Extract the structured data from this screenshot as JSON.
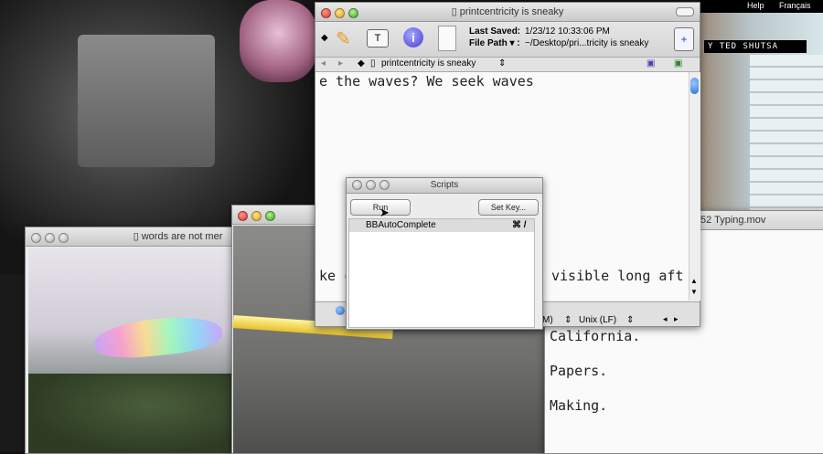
{
  "menubar": {
    "help": "Help",
    "language": "Français"
  },
  "credit": "Y TED SHUTSA",
  "bbedit": {
    "title": "printcentricity is sneaky",
    "last_saved_label": "Last Saved:",
    "last_saved_value": "1/23/12 10:33:06 PM",
    "file_path_label": "File Path ▾ :",
    "file_path_value": "~/Desktop/pri...tricity is sneaky",
    "nav_document": "printcentricity is sneaky",
    "text_line_1": "e the waves? We seek waves",
    "text_line_2": "ke c",
    "text_line_2b": "visible long aft",
    "status_encoding": "M)",
    "status_line_endings": "Unix (LF)"
  },
  "scripts": {
    "title": "Scripts",
    "run_label": "Run",
    "set_key_label": "Set Key...",
    "items": [
      {
        "name": "BBAutoComplete",
        "shortcut": "⌘ /"
      }
    ]
  },
  "words_window": {
    "title": "words are not mer"
  },
  "typing_window": {
    "title": "52 Typing.mov",
    "lines": [
      "California.",
      "Papers.",
      "Making."
    ]
  }
}
